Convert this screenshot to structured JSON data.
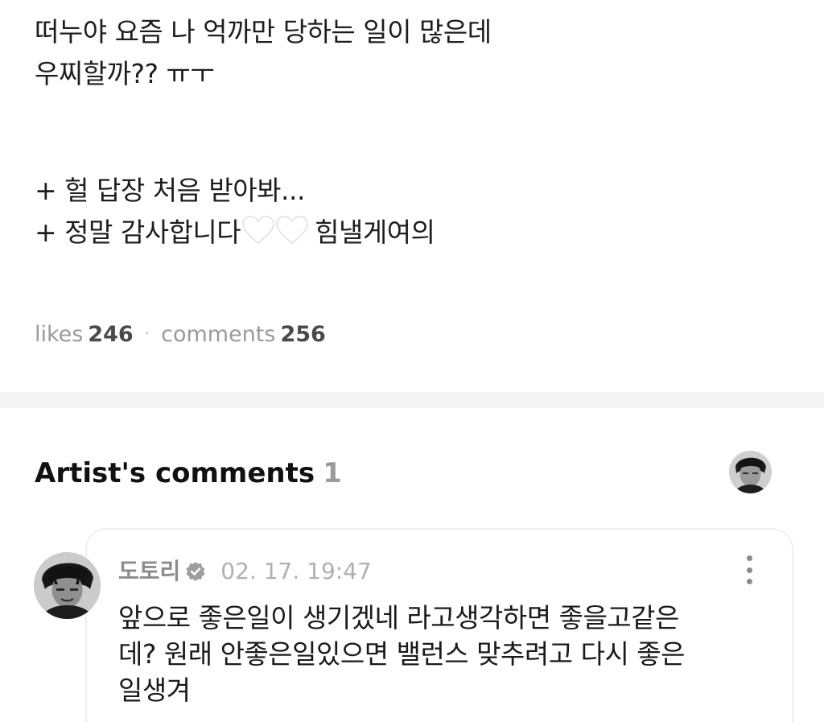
{
  "post": {
    "lines": [
      "떠누야 요즘 나 억까만 당하는 일이 많은데",
      "우찌할까?? ㅠㅜ",
      "+ 헐 답장 처음 받아봐...",
      "+ 정말 감사합니다",
      "힘낼게여의"
    ],
    "heart_icons": [
      "white-heart-icon",
      "white-heart-icon"
    ]
  },
  "stats": {
    "likes_label": "likes",
    "likes_value": "246",
    "separator": "·",
    "comments_label": "comments",
    "comments_value": "256"
  },
  "artist_comments": {
    "title": "Artist's comments",
    "count": "1",
    "comment": {
      "author": "도토리",
      "time": "02. 17. 19:47",
      "lines": [
        "앞으로 좋은일이 생기겠네 라고생각하면 좋을고같은",
        "데? 원래 안좋은일있으면 밸런스 맞추려고 다시 좋은",
        "일생겨"
      ]
    }
  },
  "colors": {
    "muted_text": "#9a9a9a",
    "divider": "#f4f4f4",
    "card_border": "#efefef"
  }
}
